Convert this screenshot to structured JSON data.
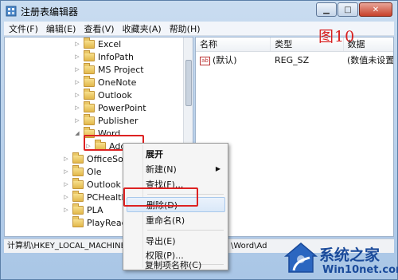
{
  "window": {
    "title": "注册表编辑器",
    "minimize": "▁",
    "maximize": "□",
    "close": "✕"
  },
  "menu": [
    "文件(F)",
    "编辑(E)",
    "查看(V)",
    "收藏夹(A)",
    "帮助(H)"
  ],
  "tree": [
    {
      "label": "Excel",
      "expander": "▷"
    },
    {
      "label": "InfoPath",
      "expander": "▷"
    },
    {
      "label": "MS Project",
      "expander": "▷"
    },
    {
      "label": "OneNote",
      "expander": "▷"
    },
    {
      "label": "Outlook",
      "expander": "▷"
    },
    {
      "label": "PowerPoint",
      "expander": "▷"
    },
    {
      "label": "Publisher",
      "expander": "▷"
    },
    {
      "label": "Word",
      "expander": "◢"
    },
    {
      "label": "Addins",
      "expander": "▷"
    },
    {
      "label": "OfficeSoftwa",
      "expander": "▷"
    },
    {
      "label": "Ole",
      "expander": "▷"
    },
    {
      "label": "Outlook Ex",
      "expander": "▷"
    },
    {
      "label": "PCHealth",
      "expander": "▷"
    },
    {
      "label": "PLA",
      "expander": "▷"
    },
    {
      "label": "PlayReady",
      "expander": ""
    }
  ],
  "list": {
    "headers": [
      "名称",
      "类型",
      "数据"
    ],
    "rows": [
      {
        "name": "(默认)",
        "type": "REG_SZ",
        "data": "(数值未设置)",
        "icon": "ab"
      }
    ]
  },
  "figure_label": "图10",
  "status": {
    "path": "计算机\\HKEY_LOCAL_MACHINE\\",
    "tail": "\\Word\\Ad"
  },
  "context_menu": {
    "items": [
      {
        "label": "展开",
        "bold": true
      },
      {
        "label": "新建(N)",
        "submenu": "▶"
      },
      {
        "label": "查找(F)..."
      },
      {
        "label": "删除(D)",
        "hovered": true
      },
      {
        "label": "重命名(R)"
      },
      {
        "label": "导出(E)"
      },
      {
        "label": "权限(P)..."
      },
      {
        "label": "复制项名称(C)"
      }
    ]
  },
  "watermark": {
    "brand": "系统之家",
    "url": "Win10net.com"
  },
  "colors": {
    "highlight": "#dd2222",
    "watermark": "#1a4a9a"
  }
}
